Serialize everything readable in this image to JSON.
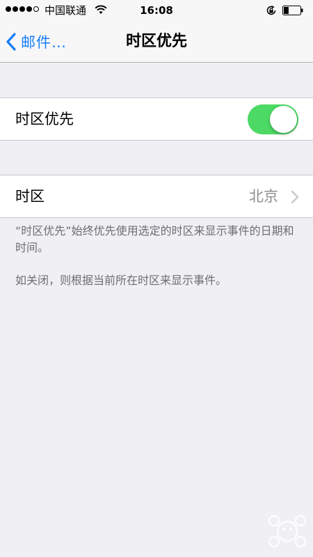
{
  "status_bar": {
    "signal_bars_filled": 4,
    "signal_bars_total": 5,
    "carrier": "中国联通",
    "time": "16:08",
    "icons": [
      "wifi-icon",
      "rotation-lock-icon",
      "battery-icon"
    ],
    "battery_level": 0.3
  },
  "nav_bar": {
    "back_label": "邮件…",
    "title": "时区优先",
    "accent_color": "#157efb"
  },
  "settings": {
    "timezone_override": {
      "label": "时区优先",
      "enabled": true,
      "toggle_color": "#4cd964"
    },
    "timezone": {
      "label": "时区",
      "value": "北京"
    }
  },
  "footer": {
    "description": "“时区优先”始终优先使用选定的时区来显示事件的日期和时间。",
    "off_note": "如关闭，则根据当前所在时区来显示事件。"
  }
}
